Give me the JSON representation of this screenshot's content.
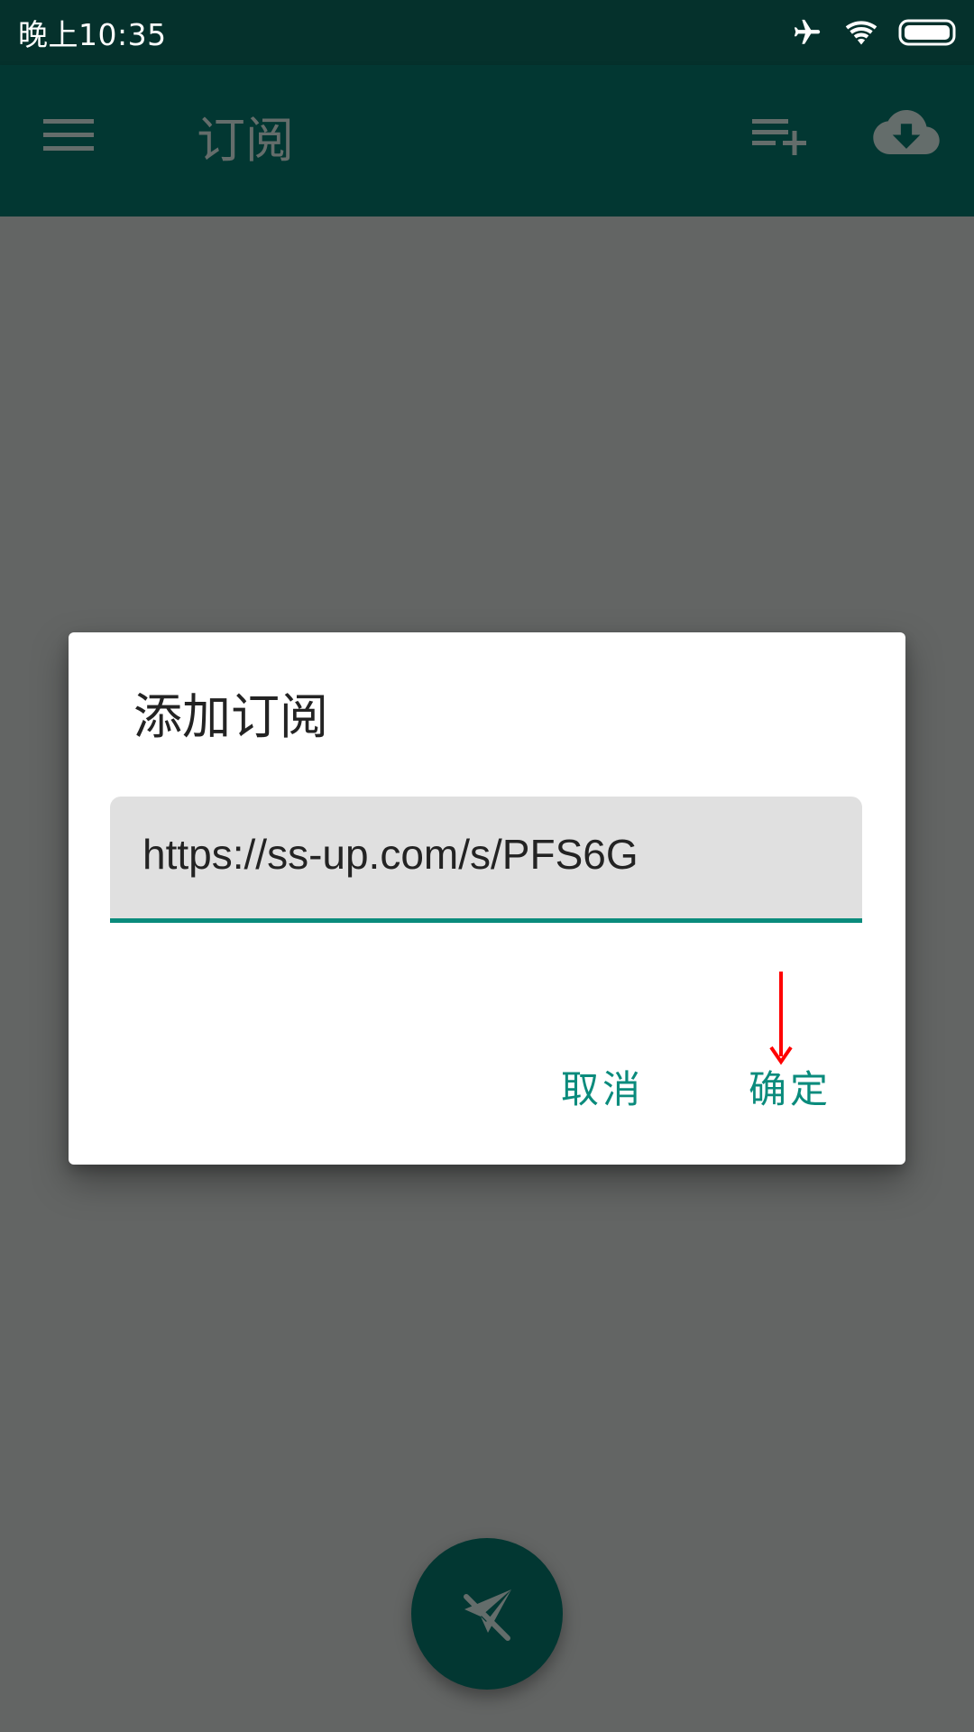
{
  "status_bar": {
    "time": "晚上10:35",
    "icons": [
      "airplane-mode-icon",
      "wifi-icon",
      "battery-icon"
    ]
  },
  "toolbar": {
    "title": "订阅",
    "menu_icon": "menu-icon",
    "actions": [
      "playlist-add-icon",
      "cloud-download-icon"
    ]
  },
  "dialog": {
    "title": "添加订阅",
    "url_value": "https://ss-up.com/s/PFS6G",
    "cancel_label": "取消",
    "ok_label": "确定"
  },
  "fab": {
    "icon": "paper-plane-off-icon"
  },
  "colors": {
    "status_bar": "#05312c",
    "toolbar": "#023732",
    "accent": "#0a8b7c",
    "annotation": "#ff0000",
    "scrim": "#636564"
  }
}
